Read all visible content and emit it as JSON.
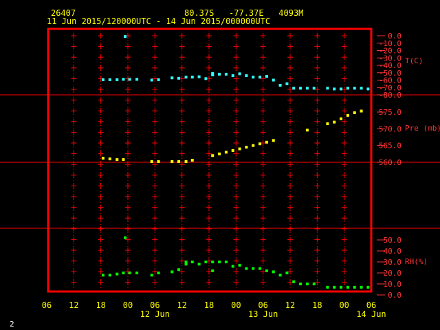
{
  "header": {
    "station_id": "26407",
    "location": "80.37S   -77.37E   4093M",
    "period": "11 Jun 2015/120000UTC - 14 Jun 2015/000000UTC"
  },
  "footer": {
    "page_number": "2"
  },
  "colors": {
    "frame": "#ff0000",
    "panel_divider": "#ff0000",
    "grid": "#ff0000",
    "axis_text": "#ffff00",
    "right_axis_text": "#ff3333",
    "temperature": "#33ffff",
    "pressure": "#ffff00",
    "humidity": "#00ff00"
  },
  "chart_data": {
    "type": "scatter",
    "x_axis": {
      "unit": "hours since 11 Jun 2015 06 UTC",
      "range": [
        0,
        72
      ],
      "tick_values": [
        0,
        6,
        12,
        18,
        24,
        30,
        36,
        42,
        48,
        54,
        60,
        66,
        72
      ],
      "tick_labels": [
        "06",
        "12",
        "18",
        "00",
        "06",
        "12",
        "18",
        "00",
        "06",
        "12",
        "18",
        "00",
        "06"
      ],
      "date_labels": [
        {
          "x": 24,
          "label": "12 Jun"
        },
        {
          "x": 48,
          "label": "13 Jun"
        },
        {
          "x": 72,
          "label": "14 Jun"
        }
      ]
    },
    "panels": [
      {
        "name": "temperature",
        "ylabel": "T(C)",
        "ylim": [
          -80,
          0
        ],
        "tick_values": [
          0,
          -10,
          -20,
          -30,
          -40,
          -50,
          -60,
          -70,
          -80
        ],
        "tick_labels": [
          "0.0",
          "-10.0",
          "-20.0",
          "-30.0",
          "-40.0",
          "-50.0",
          "-60.0",
          "-70.0",
          "-80.0"
        ],
        "series": [
          {
            "color_key": "temperature",
            "points": [
              [
                17.4,
                -1
              ],
              [
                12.5,
                -59.5
              ],
              [
                14,
                -59.5
              ],
              [
                15.6,
                -59.5
              ],
              [
                17,
                -59
              ],
              [
                18.4,
                -59
              ],
              [
                20,
                -59
              ],
              [
                23.3,
                -60
              ],
              [
                24.8,
                -59.5
              ],
              [
                27.8,
                -57
              ],
              [
                29.3,
                -57.5
              ],
              [
                30.9,
                -56
              ],
              [
                32.3,
                -56
              ],
              [
                33.8,
                -55.5
              ],
              [
                35.3,
                -58
              ],
              [
                36.8,
                -53
              ],
              [
                36.8,
                -51
              ],
              [
                38.3,
                -52
              ],
              [
                39.8,
                -52
              ],
              [
                41.3,
                -54
              ],
              [
                42.8,
                -51.5
              ],
              [
                44.3,
                -54
              ],
              [
                45.8,
                -56
              ],
              [
                47.3,
                -56
              ],
              [
                48.8,
                -55
              ],
              [
                50.3,
                -60
              ],
              [
                51.8,
                -67
              ],
              [
                53.3,
                -65
              ],
              [
                54.8,
                -71
              ],
              [
                56.3,
                -71
              ],
              [
                57.8,
                -71
              ],
              [
                59.3,
                -71
              ],
              [
                62.3,
                -71
              ],
              [
                63.8,
                -72
              ],
              [
                65.3,
                -72
              ],
              [
                66.8,
                -71
              ],
              [
                68.3,
                -71
              ],
              [
                69.8,
                -71
              ],
              [
                71.3,
                -72
              ]
            ]
          }
        ]
      },
      {
        "name": "pressure",
        "ylabel": "Pre (mb)",
        "ylim": [
          557.3,
          578.5
        ],
        "tick_values": [
          560,
          565,
          570,
          575
        ],
        "tick_labels": [
          "560.0",
          "565.0",
          "570.0",
          "575.0"
        ],
        "series": [
          {
            "color_key": "pressure",
            "points": [
              [
                12.5,
                561.2
              ],
              [
                14,
                561
              ],
              [
                15.6,
                560.8
              ],
              [
                17,
                560.8
              ],
              [
                23.3,
                560.2
              ],
              [
                24.8,
                560.2
              ],
              [
                27.8,
                560.2
              ],
              [
                29.3,
                560.2
              ],
              [
                30.9,
                560.2
              ],
              [
                32.3,
                560.6
              ],
              [
                36.8,
                562
              ],
              [
                38.3,
                562.5
              ],
              [
                39.8,
                563
              ],
              [
                41.3,
                563.5
              ],
              [
                42.8,
                564
              ],
              [
                44.3,
                564.5
              ],
              [
                45.8,
                565
              ],
              [
                47.3,
                565.5
              ],
              [
                48.8,
                566
              ],
              [
                50.3,
                566.5
              ],
              [
                57.8,
                569.6
              ],
              [
                62.3,
                571.5
              ],
              [
                63.8,
                572
              ],
              [
                65.3,
                573
              ],
              [
                66.8,
                574
              ],
              [
                68.3,
                574.8
              ],
              [
                69.8,
                575.3
              ]
            ]
          }
        ]
      },
      {
        "name": "humidity",
        "ylabel": "RH(%)",
        "ylim": [
          0,
          50
        ],
        "tick_values": [
          0,
          10,
          20,
          30,
          40,
          50
        ],
        "tick_labels": [
          "0.0",
          "10.0",
          "20.0",
          "30.0",
          "40.0",
          "50.0"
        ],
        "series": [
          {
            "color_key": "humidity",
            "points": [
              [
                17.4,
                52
              ],
              [
                12.5,
                18
              ],
              [
                14,
                18
              ],
              [
                15.6,
                19
              ],
              [
                17,
                20
              ],
              [
                18.4,
                20
              ],
              [
                20,
                20
              ],
              [
                23.3,
                18
              ],
              [
                24.8,
                20
              ],
              [
                27.8,
                21
              ],
              [
                29.3,
                23
              ],
              [
                30.9,
                28
              ],
              [
                30.9,
                30
              ],
              [
                32.3,
                30
              ],
              [
                33.8,
                28
              ],
              [
                35.3,
                30
              ],
              [
                36.8,
                30
              ],
              [
                36.8,
                22
              ],
              [
                38.3,
                30
              ],
              [
                39.8,
                30
              ],
              [
                41.3,
                26
              ],
              [
                42.8,
                27
              ],
              [
                44.3,
                24
              ],
              [
                45.8,
                24
              ],
              [
                47.3,
                24
              ],
              [
                48.8,
                22
              ],
              [
                50.3,
                21
              ],
              [
                51.8,
                18
              ],
              [
                53.3,
                20
              ],
              [
                54.8,
                12
              ],
              [
                56.3,
                10
              ],
              [
                57.8,
                10
              ],
              [
                59.3,
                10
              ],
              [
                62.3,
                7
              ],
              [
                63.8,
                7
              ],
              [
                65.3,
                7
              ],
              [
                66.8,
                7
              ],
              [
                68.3,
                7
              ],
              [
                69.8,
                7
              ],
              [
                71.3,
                7
              ]
            ]
          }
        ]
      }
    ]
  }
}
